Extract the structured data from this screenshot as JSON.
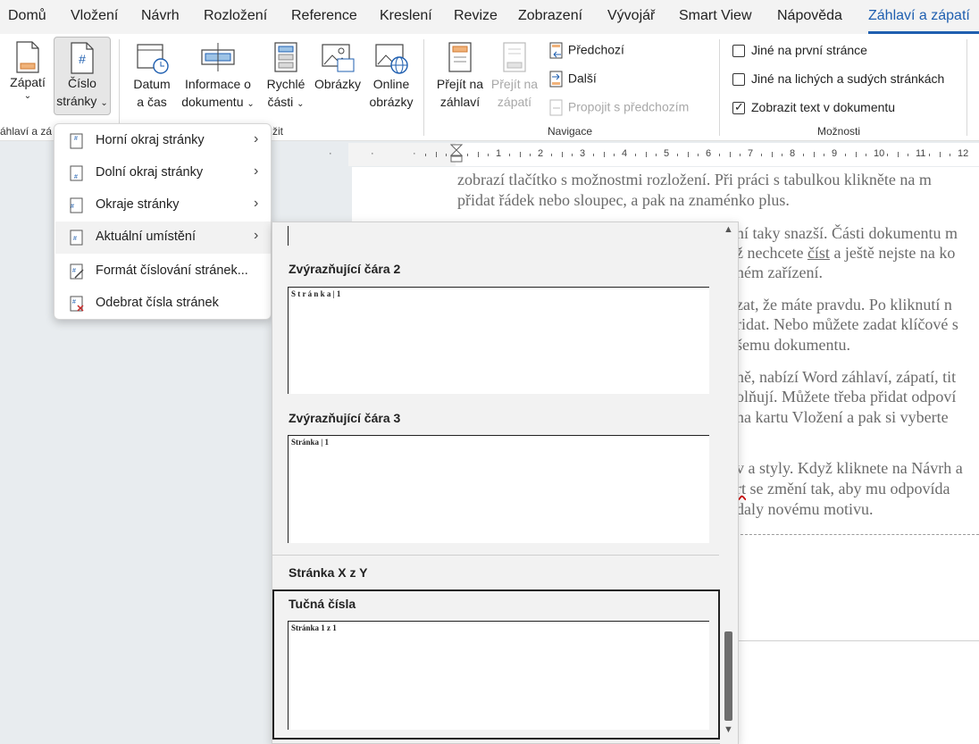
{
  "tabs": [
    "Domů",
    "Vložení",
    "Návrh",
    "Rozložení",
    "Reference",
    "Kreslení",
    "Revize",
    "Zobrazení",
    "Vývojář",
    "Smart View",
    "Nápověda",
    "Záhlaví a zápatí"
  ],
  "ribbon": {
    "zapati": "Zápatí",
    "cislo_1": "Číslo",
    "cislo_2": "stránky",
    "datum_1": "Datum",
    "datum_2": "a čas",
    "info_1": "Informace o",
    "info_2": "dokumentu",
    "rychle_1": "Rychlé",
    "rychle_2": "části",
    "obrazky": "Obrázky",
    "online_1": "Online",
    "online_2": "obrázky",
    "prejit_zahlavi_1": "Přejít na",
    "prejit_zahlavi_2": "záhlaví",
    "prejit_zapati_1": "Přejít na",
    "prejit_zapati_2": "zápatí",
    "predchozi": "Předchozí",
    "dalsi": "Další",
    "propojit": "Propojit s předchozím",
    "group_zahlavi": "áhlaví a zá",
    "group_vlozit": "žit",
    "group_navigace": "Navigace",
    "group_moznosti": "Možnosti",
    "opt1": "Jiné na první stránce",
    "opt2": "Jiné na lichých a sudých stránkách",
    "opt3": "Zobrazit text v dokumentu"
  },
  "options_checked": [
    false,
    false,
    true
  ],
  "ruler": [
    "1",
    "2",
    "3",
    "4",
    "5",
    "6",
    "7",
    "8",
    "9",
    "10",
    "11",
    "12"
  ],
  "doc": {
    "l1": "zobrazí tlačítko s možnostmi rozložení. Při práci s tabulkou klikněte na m",
    "l2": "přidat řádek nebo sloupec, a pak na znaménko plus.",
    "l3": "ní taky snazší. Části dokumentu m",
    "l4a": "ž nechcete ",
    "l4b": "číst",
    "l4c": " a ještě nejste na ko",
    "l5": "ném zařízení.",
    "l6": "zat, že máte pravdu. Po kliknutí n",
    "l7": "ridat. Nebo můžete zadat klíčové s",
    "l8": "šemu dokumentu.",
    "l9": "ně, nabízí Word záhlaví, zápatí, tit",
    "l10": "olňují. Můžete třeba přidat odpoví",
    "l11": " na kartu Vložení a pak si vyberte",
    "l12": "v a styly. Když kliknete na Návrh a",
    "l13a": "rt",
    "l13b": " se změní tak, aby mu odpovída",
    "l14": "daly novému motivu."
  },
  "menu": [
    {
      "label": "Horní okraj stránky",
      "arrow": true
    },
    {
      "label": "Dolní okraj stránky",
      "arrow": true
    },
    {
      "label": "Okraje stránky",
      "arrow": true
    },
    {
      "label": "Aktuální umístění",
      "arrow": true
    },
    {
      "label": "Formát číslování stránek...",
      "arrow": false
    },
    {
      "label": "Odebrat čísla stránek",
      "arrow": false
    }
  ],
  "gallery": {
    "item1_title": "Zvýrazňující čára 2",
    "item1_text": "S t r á n k a  | 1",
    "item2_title": "Zvýrazňující čára 3",
    "item2_text": "Stránka | 1",
    "section": "Stránka X z Y",
    "item3_title": "Tučná čísla",
    "item3_text": "Stránka 1 z 1"
  },
  "colors": {
    "accent": "#1f5fb0",
    "gallery_bg": "#f2f2f2",
    "doc_text": "#6b6b6b"
  }
}
